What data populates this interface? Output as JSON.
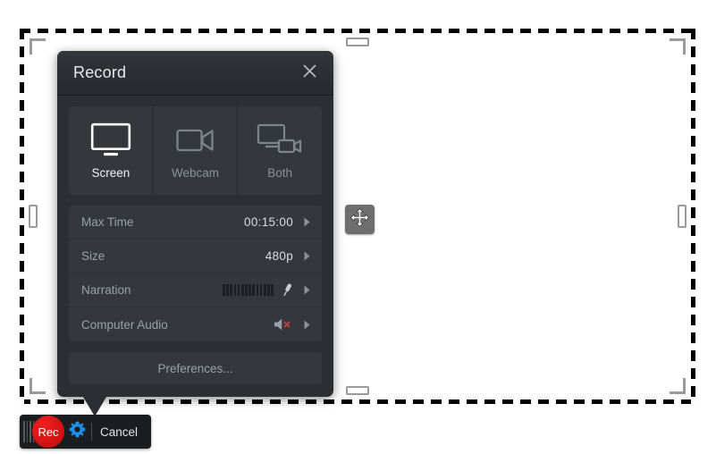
{
  "panel": {
    "title": "Record",
    "close_icon": "close-icon",
    "modes": [
      {
        "id": "screen",
        "label": "Screen",
        "icon": "monitor-icon",
        "selected": true
      },
      {
        "id": "webcam",
        "label": "Webcam",
        "icon": "video-camera-icon",
        "selected": false
      },
      {
        "id": "both",
        "label": "Both",
        "icon": "monitor-and-camera-icon",
        "selected": false
      }
    ],
    "settings": [
      {
        "id": "max-time",
        "label": "Max Time",
        "value": "00:15:00",
        "control": "value",
        "chevron": "chevron-right-icon"
      },
      {
        "id": "size",
        "label": "Size",
        "value": "480p",
        "control": "value",
        "chevron": "chevron-right-icon"
      },
      {
        "id": "narration",
        "label": "Narration",
        "value": "",
        "control": "meter-mic",
        "icon": "microphone-icon",
        "chevron": "chevron-right-icon"
      },
      {
        "id": "computer-audio",
        "label": "Computer Audio",
        "value": "",
        "control": "muted-speaker",
        "icon": "speaker-muted-icon",
        "chevron": "chevron-right-icon"
      }
    ],
    "preferences_label": "Preferences..."
  },
  "control_bar": {
    "grip_icon": "drag-grip-icon",
    "record_label": "Rec",
    "settings_icon": "gear-icon",
    "cancel_label": "Cancel"
  },
  "capture_region": {
    "move_handle_icon": "move-arrows-icon",
    "corner_handles": [
      "top-left",
      "top-right",
      "bottom-left",
      "bottom-right"
    ],
    "edge_handles": [
      "top",
      "bottom",
      "left",
      "right"
    ]
  },
  "colors": {
    "panel_bg": "#2b2e33",
    "panel_row_bg": "#34383d",
    "titlebar_bg": "#32353a",
    "record_red": "#d81414",
    "gear_blue": "#1e90e8",
    "mute_red": "#cc3a3a",
    "label_gray": "#9aa0a5",
    "value_white": "#d9dbdd",
    "handle_gray": "#9a9a9a",
    "move_handle_bg": "#6e6e6e",
    "bar_bg": "#1c1d1f"
  }
}
